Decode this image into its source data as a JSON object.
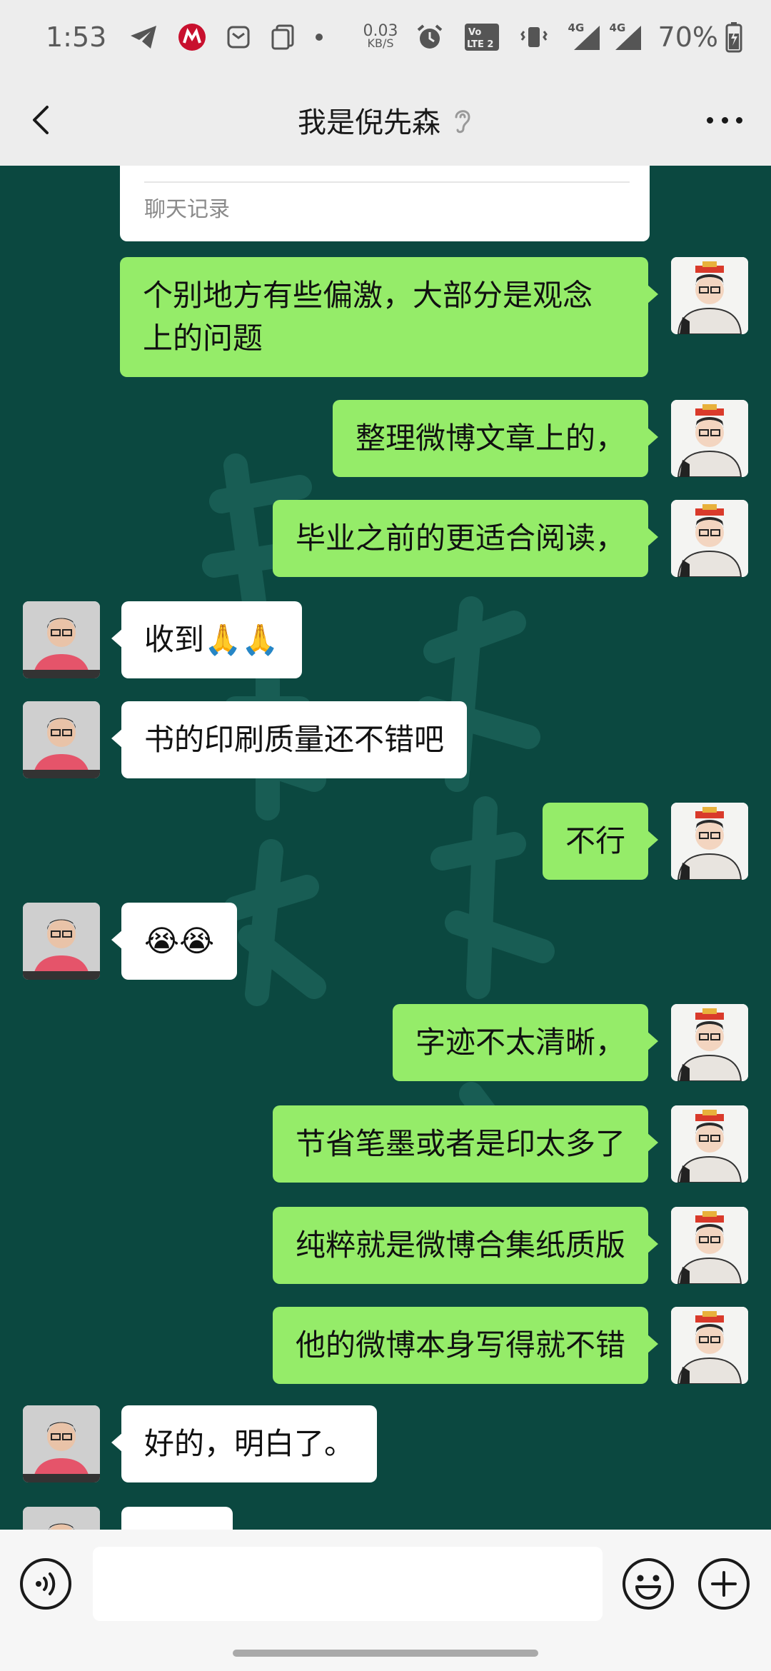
{
  "status_bar": {
    "time": "1:53",
    "net_speed_value": "0.03",
    "net_speed_unit": "KB/S",
    "volte_label": "Vo LTE 2",
    "signal1_label": "4G",
    "signal2_label": "4G",
    "battery": "70%"
  },
  "header": {
    "title": "我是倪先森"
  },
  "chat_record_card": {
    "label": "聊天记录"
  },
  "messages": [
    {
      "side": "me",
      "text": "个别地方有些偏激，大部分是观念上的问题"
    },
    {
      "side": "me",
      "text": "整理微博文章上的，"
    },
    {
      "side": "me",
      "text": "毕业之前的更适合阅读，"
    },
    {
      "side": "them",
      "text": "收到🙏🙏"
    },
    {
      "side": "them",
      "text": "书的印刷质量还不错吧"
    },
    {
      "side": "me",
      "text": "不行"
    },
    {
      "side": "them",
      "text": "😭😭"
    },
    {
      "side": "me",
      "text": "字迹不太清晰，"
    },
    {
      "side": "me",
      "text": "节省笔墨或者是印太多了"
    },
    {
      "side": "me",
      "text": "纯粹就是微博合集纸质版"
    },
    {
      "side": "me",
      "text": "他的微博本身写得就不错"
    },
    {
      "side": "them",
      "text": "好的，明白了。"
    }
  ],
  "input": {
    "placeholder": "",
    "value": ""
  },
  "colors": {
    "chat_background": "#0b4840",
    "my_bubble": "#95ec69",
    "their_bubble": "#ffffff",
    "bar_background": "#ededed"
  },
  "icons": [
    "telegram-icon",
    "cmb-bank-icon",
    "mail-icon",
    "clipboard-icon",
    "alarm-icon",
    "vibrate-icon",
    "battery-charging-icon",
    "back-arrow-icon",
    "ear-icon",
    "more-icon",
    "voice-icon",
    "emoji-icon",
    "plus-icon"
  ]
}
